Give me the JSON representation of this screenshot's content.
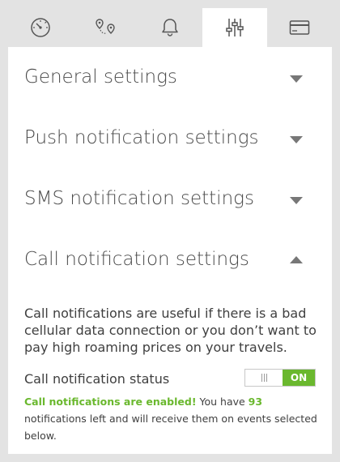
{
  "tabs": [
    {
      "icon": "speedometer-icon"
    },
    {
      "icon": "route-icon"
    },
    {
      "icon": "bell-icon"
    },
    {
      "icon": "sliders-icon",
      "active": true
    },
    {
      "icon": "credit-card-icon"
    }
  ],
  "sections": [
    {
      "title": "General settings",
      "expanded": false
    },
    {
      "title": "Push notification settings",
      "expanded": false
    },
    {
      "title": "SMS notification settings",
      "expanded": false
    },
    {
      "title": "Call notification settings",
      "expanded": true
    }
  ],
  "call": {
    "description": "Call notifications are useful if there is a bad cellular data connection or you don’t want to pay high roaming prices on your travels.",
    "status_label": "Call notification status",
    "toggle_label": "ON",
    "enabled_text": "Call notifications are enabled!",
    "you_have": " You have ",
    "count": "93",
    "rest": " notifications left and will receive them on events selected below."
  },
  "colors": {
    "accent": "#6ab82e",
    "text": "#3f3f3f",
    "background": "#e3e3e3"
  }
}
